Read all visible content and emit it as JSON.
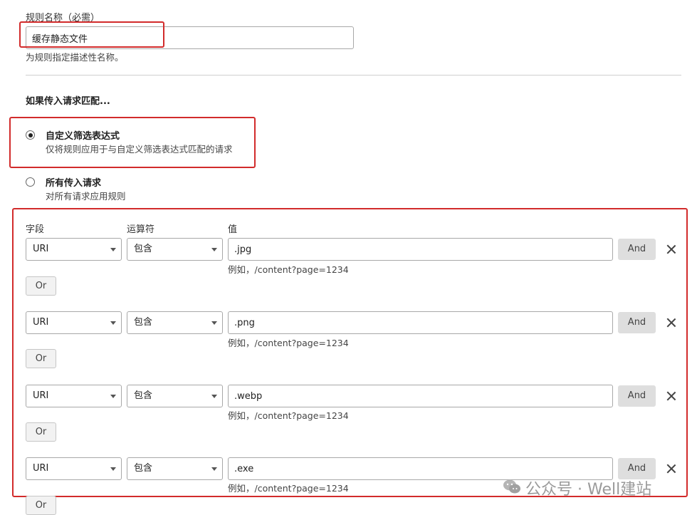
{
  "rule_name": {
    "label": "规则名称（必需）",
    "value": "缓存静态文件",
    "hint": "为规则指定描述性名称。"
  },
  "match_heading": "如果传入请求匹配...",
  "match_options": [
    {
      "title": "自定义筛选表达式",
      "desc": "仅将规则应用于与自定义筛选表达式匹配的请求",
      "checked": true
    },
    {
      "title": "所有传入请求",
      "desc": "对所有请求应用规则",
      "checked": false
    }
  ],
  "expression": {
    "headers": {
      "field": "字段",
      "operator": "运算符",
      "value": "值"
    },
    "rows": [
      {
        "field": "URI",
        "operator": "包含",
        "value": ".jpg",
        "hint": "例如，/content?page=1234"
      },
      {
        "field": "URI",
        "operator": "包含",
        "value": ".png",
        "hint": "例如，/content?page=1234"
      },
      {
        "field": "URI",
        "operator": "包含",
        "value": ".webp",
        "hint": "例如，/content?page=1234"
      },
      {
        "field": "URI",
        "operator": "包含",
        "value": ".exe",
        "hint": "例如，/content?page=1234"
      }
    ],
    "and_label": "And",
    "or_label": "Or"
  },
  "watermark": "公众号 · Well建站",
  "colors": {
    "highlight_border": "#d22b2b",
    "button_bg": "#dedede"
  }
}
